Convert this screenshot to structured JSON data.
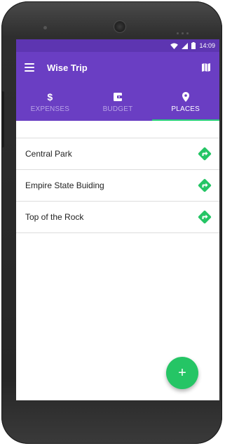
{
  "status_bar": {
    "time": "14:09",
    "icons": [
      "wifi-icon",
      "signal-icon",
      "battery-icon"
    ]
  },
  "app_bar": {
    "title": "Wise Trip",
    "icons": [
      "menu-icon",
      "map-icon"
    ]
  },
  "tabs": [
    {
      "label": "EXPENSES",
      "icon": "dollar-icon",
      "active": false
    },
    {
      "label": "BUDGET",
      "icon": "wallet-icon",
      "active": false
    },
    {
      "label": "PLACES",
      "icon": "location-pin-icon",
      "active": true
    }
  ],
  "places": [
    {
      "name": "Central Park",
      "icon": "directions-icon"
    },
    {
      "name": "Empire State Buiding",
      "icon": "directions-icon"
    },
    {
      "name": "Top of the Rock",
      "icon": "directions-icon"
    }
  ],
  "fab": {
    "label": "+",
    "icon": "add-icon"
  },
  "colors": {
    "primary": "#6a3ec3",
    "primary_dark": "#5d35b1",
    "accent": "#25c565",
    "tab_inactive": "#b9a3e6"
  }
}
